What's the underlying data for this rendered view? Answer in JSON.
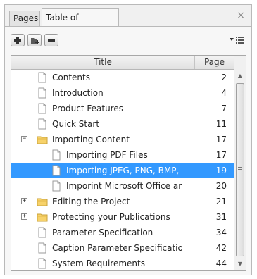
{
  "tabs": [
    {
      "label": "Pages",
      "active": false
    },
    {
      "label": "Table of Contents",
      "active": true
    }
  ],
  "close_icon": "close-icon",
  "toolbar": {
    "buttons": [
      "add-icon",
      "add-folder-icon",
      "remove-icon"
    ],
    "menu_icon": "list-options-icon"
  },
  "table": {
    "headers": {
      "title": "Title",
      "page": "Page"
    },
    "rows": [
      {
        "label": "Contents",
        "page": "2",
        "level": 0,
        "type": "page",
        "expander": "",
        "selected": false
      },
      {
        "label": "Introduction",
        "page": "4",
        "level": 0,
        "type": "page",
        "expander": "",
        "selected": false
      },
      {
        "label": "Product Features",
        "page": "7",
        "level": 0,
        "type": "page",
        "expander": "",
        "selected": false
      },
      {
        "label": "Quick Start",
        "page": "11",
        "level": 0,
        "type": "page",
        "expander": "",
        "selected": false
      },
      {
        "label": "Importing Content",
        "page": "17",
        "level": 0,
        "type": "folder",
        "expander": "−",
        "selected": false
      },
      {
        "label": "Importing PDF Files",
        "page": "17",
        "level": 1,
        "type": "page",
        "expander": "",
        "selected": false
      },
      {
        "label": "Importing JPEG, PNG, BMP, TIFF...",
        "page": "19",
        "level": 1,
        "type": "page",
        "expander": "",
        "selected": true
      },
      {
        "label": "Imporint Microsoft Office and...",
        "page": "20",
        "level": 1,
        "type": "page",
        "expander": "",
        "selected": false
      },
      {
        "label": "Editing the Project",
        "page": "21",
        "level": 0,
        "type": "folder",
        "expander": "+",
        "selected": false
      },
      {
        "label": "Protecting your Publications",
        "page": "31",
        "level": 0,
        "type": "folder",
        "expander": "+",
        "selected": false
      },
      {
        "label": "Parameter Specification",
        "page": "34",
        "level": 0,
        "type": "page",
        "expander": "",
        "selected": false
      },
      {
        "label": "Caption Parameter Specification",
        "page": "42",
        "level": 0,
        "type": "page",
        "expander": "",
        "selected": false
      },
      {
        "label": "System Requirements",
        "page": "44",
        "level": 0,
        "type": "page",
        "expander": "",
        "selected": false
      }
    ]
  },
  "colors": {
    "selection": "#3399ff",
    "folder": "#f2c94c"
  }
}
